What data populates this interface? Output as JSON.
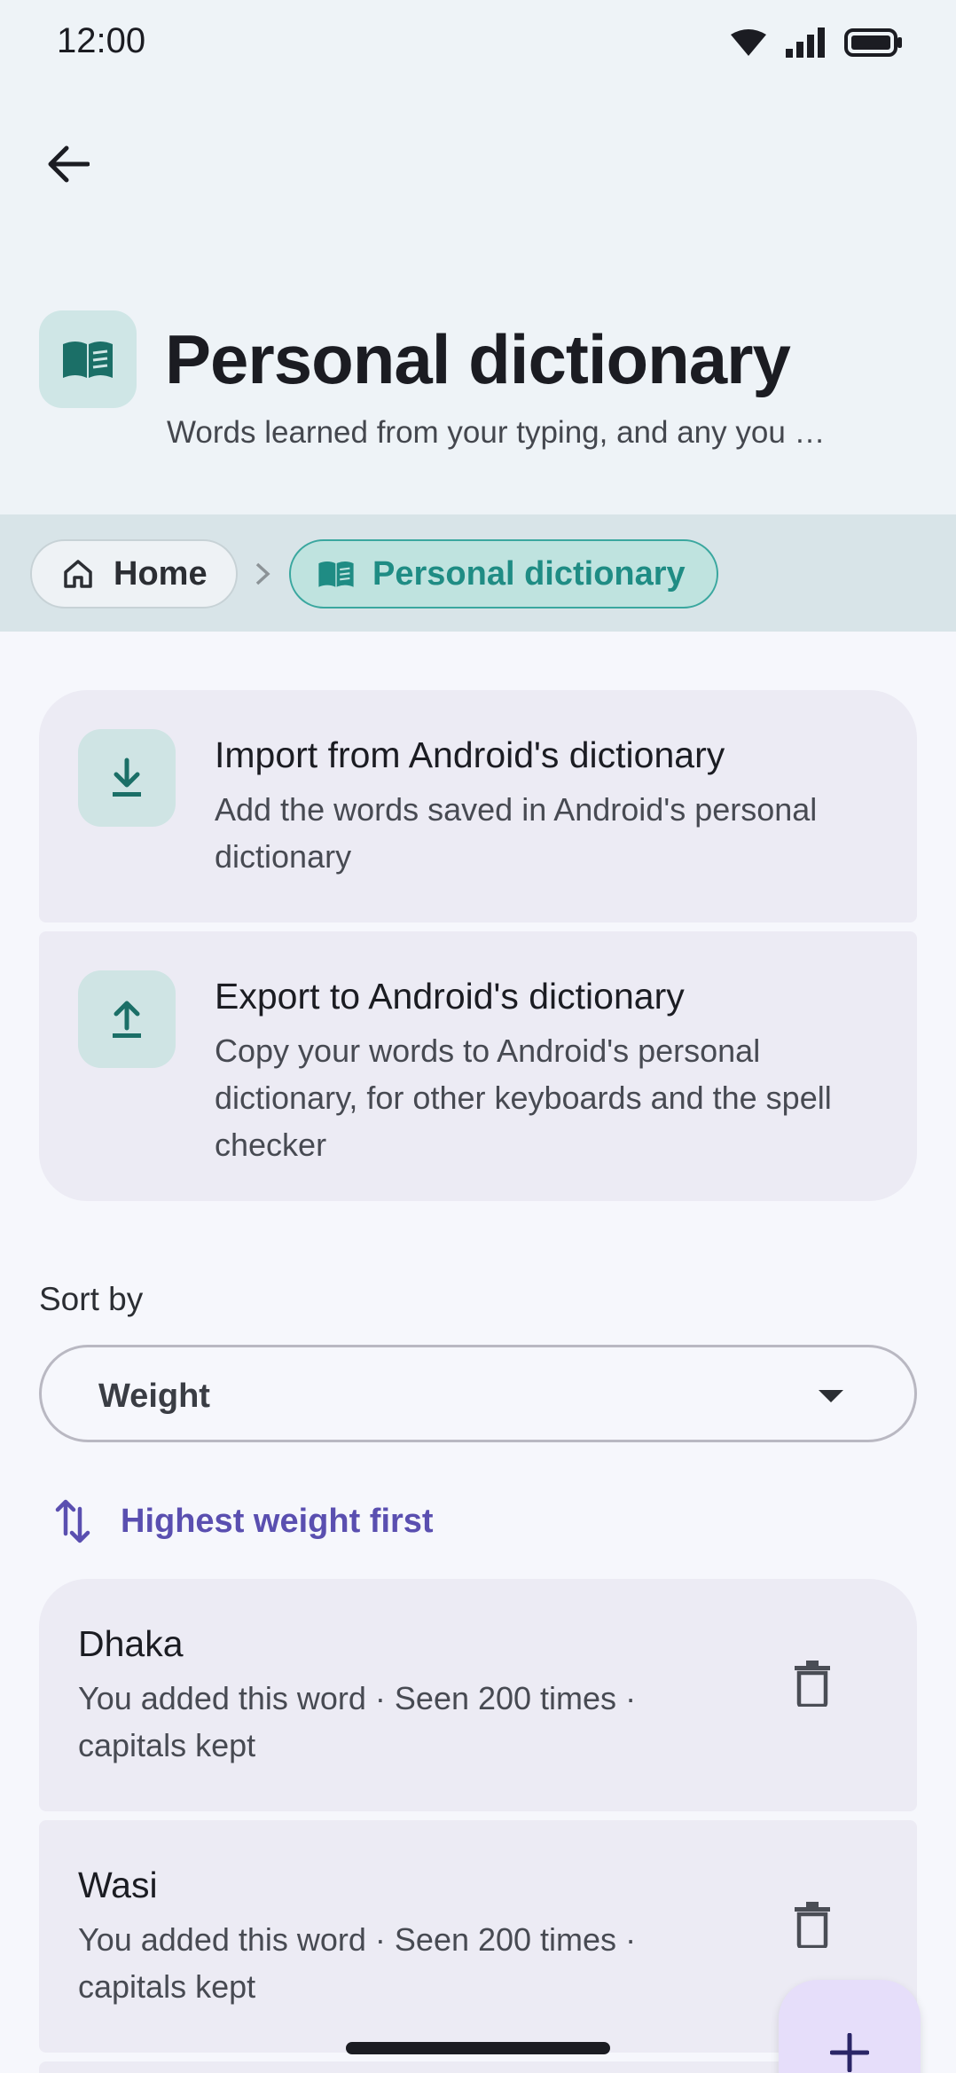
{
  "status_bar": {
    "time": "12:00"
  },
  "header": {
    "title": "Personal dictionary",
    "subtitle": "Words learned from your typing, and any you …"
  },
  "breadcrumb": {
    "home_label": "Home",
    "current_label": "Personal dictionary"
  },
  "actions": [
    {
      "title": "Import from Android's dictionary",
      "description": "Add the words saved in Android's personal dictionary",
      "icon": "download-icon"
    },
    {
      "title": "Export to Android's dictionary",
      "description": "Copy your words to Android's personal dictionary, for other keyboards and the spell checker",
      "icon": "upload-icon"
    }
  ],
  "sort": {
    "label": "Sort by",
    "selected": "Weight",
    "order_label": "Highest weight first"
  },
  "words": [
    {
      "word": "Dhaka",
      "details": "You added this word · Seen 200 times · capitals kept"
    },
    {
      "word": "Wasi",
      "details": "You added this word · Seen 200 times · capitals kept"
    }
  ],
  "colors": {
    "accent_teal": "#1f8c84",
    "accent_purple": "#5a4fb0",
    "card_bg": "#ecebf4",
    "header_bg": "#eef3f7"
  }
}
